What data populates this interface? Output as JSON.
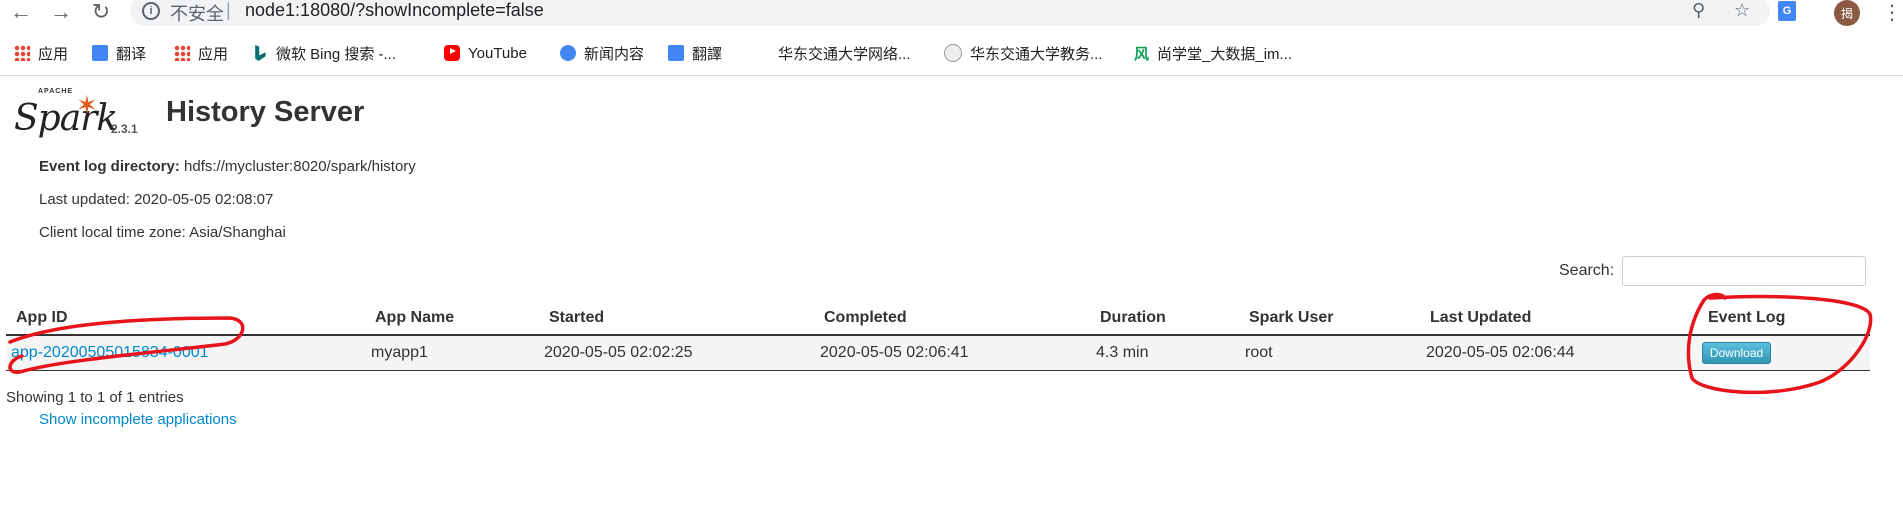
{
  "browser": {
    "insecure_label": "不安全",
    "url": "node1:18080/?showIncomplete=false",
    "avatar_text": "揭",
    "ext_text": "G"
  },
  "bookmarks": [
    {
      "label": "应用",
      "icon": "apps-icon"
    },
    {
      "label": "翻译",
      "icon": "translate-icon"
    },
    {
      "label": "应用",
      "icon": "apps-icon"
    },
    {
      "label": "微软 Bing 搜索 -...",
      "icon": "bing-icon"
    },
    {
      "label": "YouTube",
      "icon": "youtube-icon"
    },
    {
      "label": "新闻内容",
      "icon": "news-icon"
    },
    {
      "label": "翻譯",
      "icon": "translate-icon"
    },
    {
      "label": "华东交通大学网络...",
      "icon": ""
    },
    {
      "label": "华东交通大学教务...",
      "icon": "school-icon"
    },
    {
      "label": "尚学堂_大数据_im...",
      "icon": "feng-icon"
    }
  ],
  "logo": {
    "apache": "APACHE",
    "spark": "Spark",
    "version": "2.3.1"
  },
  "page": {
    "title": "History Server",
    "event_log_dir_label": "Event log directory:",
    "event_log_dir_value": "hdfs://mycluster:8020/spark/history",
    "last_updated": "Last updated: 2020-05-05 02:08:07",
    "timezone": "Client local time zone: Asia/Shanghai",
    "search_label": "Search:",
    "search_value": ""
  },
  "table": {
    "headers": [
      "App ID",
      "App Name",
      "Started",
      "Completed",
      "Duration",
      "Spark User",
      "Last Updated",
      "Event Log"
    ],
    "rows": [
      {
        "app_id": "app-20200505015834-0001",
        "app_name": "myapp1",
        "started": "2020-05-05 02:02:25",
        "completed": "2020-05-05 02:06:41",
        "duration": "4.3 min",
        "user": "root",
        "last_updated": "2020-05-05 02:06:44",
        "event_log": "Download"
      }
    ],
    "entries_text": "Showing 1 to 1 of 1 entries",
    "incomplete_link": "Show incomplete applications"
  },
  "colors": {
    "link": "#0088cc",
    "button": "#3aa4c6",
    "annotation": "#e8141c",
    "spark_orange": "#e25a1c"
  }
}
